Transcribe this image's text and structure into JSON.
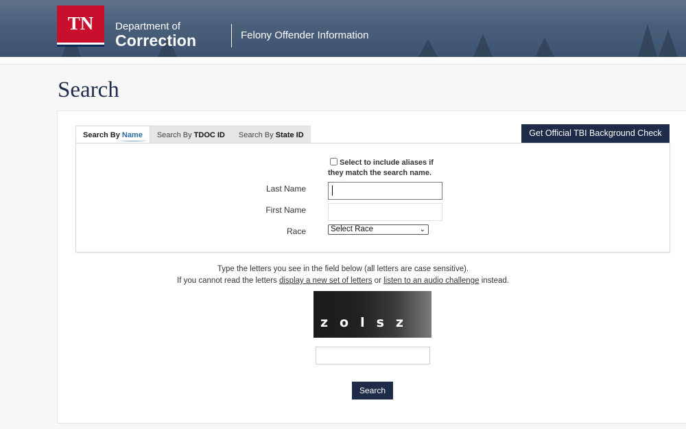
{
  "header": {
    "logo_text": "TN",
    "dept_line1": "Department of",
    "dept_line2": "Correction",
    "site_title": "Felony Offender Information"
  },
  "page_title": "Search",
  "tabs": [
    {
      "prefix": "Search By ",
      "bold": "Name",
      "active": true
    },
    {
      "prefix": "Search By ",
      "bold": "TDOC ID",
      "active": false
    },
    {
      "prefix": "Search By ",
      "bold": "State ID",
      "active": false
    }
  ],
  "tbi_button": "Get Official TBI Background Check",
  "form": {
    "alias_line1": "Select to include aliases if",
    "alias_line2": "they match the search name.",
    "last_name_label": "Last Name",
    "last_name_value": "",
    "first_name_label": "First Name",
    "first_name_value": "",
    "race_label": "Race",
    "race_selected": "Select Race"
  },
  "captcha": {
    "instruction": "Type the letters you see in the field below (all letters are case sensitive).",
    "line2_before": "If you cannot read the letters ",
    "new_set_link": "display a new set of letters",
    "line2_mid": " or ",
    "audio_link": "listen to an audio challenge",
    "line2_after": " instead.",
    "image_letters": "zolsz",
    "input_value": ""
  },
  "search_button": "Search",
  "colors": {
    "navy": "#1e2c4a",
    "tn_red": "#c8102e",
    "header_blue": "#4a5f7a"
  }
}
